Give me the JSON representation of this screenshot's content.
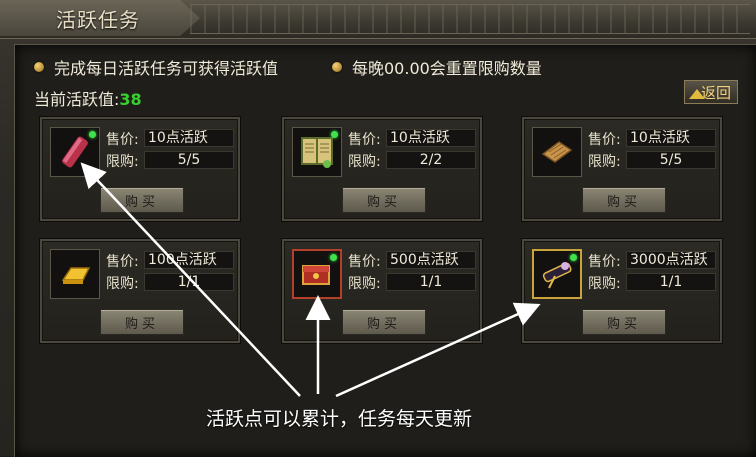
{
  "window": {
    "title": "活跃任务"
  },
  "info": {
    "line1": "完成每日活跃任务可获得活跃值",
    "line2": "每晚00.00会重置限购数量",
    "activity_label": "当前活跃值:",
    "activity_value": "38",
    "back_label": "返回"
  },
  "labels": {
    "price": "售价:",
    "limit": "限购:",
    "buy": "购买"
  },
  "items": [
    {
      "icon": "red-scroll-icon",
      "price": "10点活跃",
      "limit": "5/5"
    },
    {
      "icon": "open-book-icon",
      "price": "10点活跃",
      "limit": "2/2"
    },
    {
      "icon": "parchment-scroll-icon",
      "price": "10点活跃",
      "limit": "5/5"
    },
    {
      "icon": "gold-bar-icon",
      "price": "100点活跃",
      "limit": "1/1"
    },
    {
      "icon": "red-chest-icon",
      "price": "500点活跃",
      "limit": "1/1"
    },
    {
      "icon": "telescope-icon",
      "price": "3000点活跃",
      "limit": "1/1"
    }
  ],
  "annotation": "活跃点可以累计，任务每天更新"
}
